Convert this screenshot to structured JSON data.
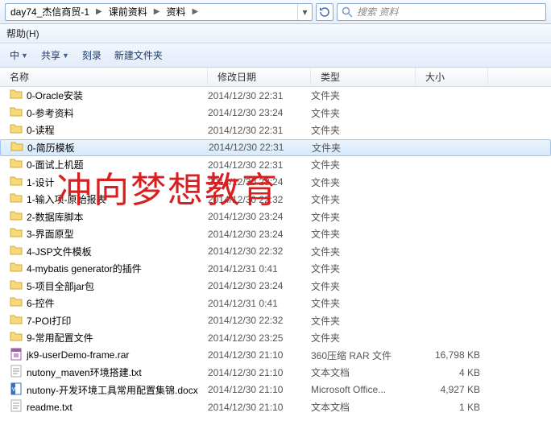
{
  "breadcrumb": {
    "parts": [
      "day74_杰信商贸-1",
      "课前资料",
      "资料"
    ]
  },
  "search": {
    "placeholder": "搜索 资料"
  },
  "menu": {
    "help": "帮助(H)"
  },
  "toolbar": {
    "include": "中",
    "share": "共享",
    "burn": "刻录",
    "newfolder": "新建文件夹"
  },
  "columns": {
    "name": "名称",
    "date": "修改日期",
    "type": "类型",
    "size": "大小"
  },
  "rows": [
    {
      "icon": "folder",
      "name": "0-Oracle安装",
      "date": "2014/12/30 22:31",
      "type": "文件夹",
      "size": ""
    },
    {
      "icon": "folder",
      "name": "0-参考资料",
      "date": "2014/12/30 23:24",
      "type": "文件夹",
      "size": ""
    },
    {
      "icon": "folder",
      "name": "0-读程",
      "date": "2014/12/30 22:31",
      "type": "文件夹",
      "size": ""
    },
    {
      "icon": "folder",
      "name": "0-简历模板",
      "date": "2014/12/30 22:31",
      "type": "文件夹",
      "size": "",
      "selected": true
    },
    {
      "icon": "folder",
      "name": "0-面试上机题",
      "date": "2014/12/30 22:31",
      "type": "文件夹",
      "size": ""
    },
    {
      "icon": "folder",
      "name": "1-设计",
      "date": "2014/12/30 23:24",
      "type": "文件夹",
      "size": ""
    },
    {
      "icon": "folder",
      "name": "1-输入项-原始报表",
      "date": "2014/12/30 22:32",
      "type": "文件夹",
      "size": ""
    },
    {
      "icon": "folder",
      "name": "2-数据库脚本",
      "date": "2014/12/30 23:24",
      "type": "文件夹",
      "size": ""
    },
    {
      "icon": "folder",
      "name": "3-界面原型",
      "date": "2014/12/30 23:24",
      "type": "文件夹",
      "size": ""
    },
    {
      "icon": "folder",
      "name": "4-JSP文件模板",
      "date": "2014/12/30 22:32",
      "type": "文件夹",
      "size": ""
    },
    {
      "icon": "folder",
      "name": "4-mybatis generator的插件",
      "date": "2014/12/31 0:41",
      "type": "文件夹",
      "size": ""
    },
    {
      "icon": "folder",
      "name": "5-项目全部jar包",
      "date": "2014/12/30 23:24",
      "type": "文件夹",
      "size": ""
    },
    {
      "icon": "folder",
      "name": "6-控件",
      "date": "2014/12/31 0:41",
      "type": "文件夹",
      "size": ""
    },
    {
      "icon": "folder",
      "name": "7-POI打印",
      "date": "2014/12/30 22:32",
      "type": "文件夹",
      "size": ""
    },
    {
      "icon": "folder",
      "name": "9-常用配置文件",
      "date": "2014/12/30 23:25",
      "type": "文件夹",
      "size": ""
    },
    {
      "icon": "rar",
      "name": "jk9-userDemo-frame.rar",
      "date": "2014/12/30 21:10",
      "type": "360压缩 RAR 文件",
      "size": "16,798 KB"
    },
    {
      "icon": "txt",
      "name": "nutony_maven环境搭建.txt",
      "date": "2014/12/30 21:10",
      "type": "文本文档",
      "size": "4 KB"
    },
    {
      "icon": "docx",
      "name": "nutony-开发环境工具常用配置集锦.docx",
      "date": "2014/12/30 21:10",
      "type": "Microsoft Office...",
      "size": "4,927 KB"
    },
    {
      "icon": "txt",
      "name": "readme.txt",
      "date": "2014/12/30 21:10",
      "type": "文本文档",
      "size": "1 KB"
    }
  ],
  "watermark": "冲向梦想教育"
}
